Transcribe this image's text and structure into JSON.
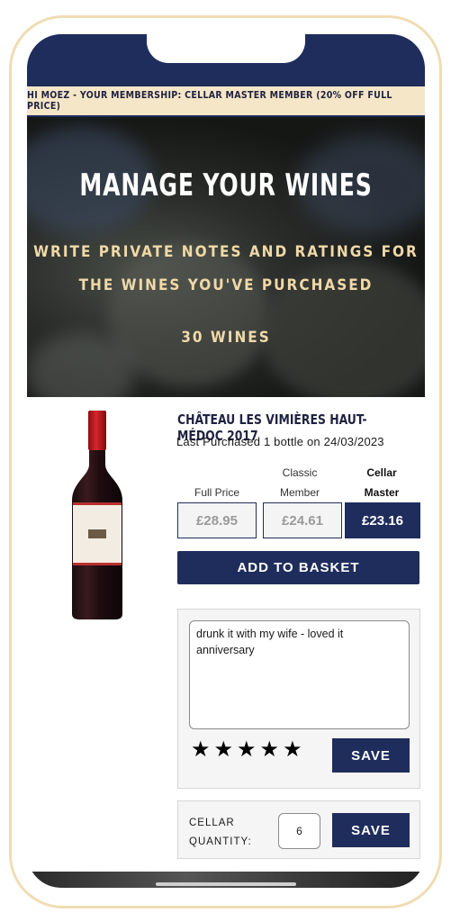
{
  "banner": {
    "text": "HI MOEZ - YOUR MEMBERSHIP: CELLAR MASTER MEMBER (20% OFF FULL PRICE)"
  },
  "hero": {
    "title": "MANAGE YOUR WINES",
    "subtitle": "WRITE PRIVATE NOTES AND RATINGS FOR THE WINES YOU'VE PURCHASED",
    "count": "30 WINES"
  },
  "product": {
    "name": "CHÂTEAU LES VIMIÈRES HAUT-MÉDOC 2017",
    "last_purchased": "Last Purchased 1 bottle on 24/03/2023",
    "bottle_label": "Château les Vimières",
    "bottle_sublabel": "HAUT-MÉDOC",
    "bottle_year": "2017"
  },
  "prices": {
    "full": {
      "label": "Full Price",
      "value": "£28.95"
    },
    "classic": {
      "label_line1": "Classic",
      "label_line2": "Member",
      "value": "£24.61"
    },
    "cellar": {
      "label_line1": "Cellar",
      "label_line2": "Master",
      "value": "£23.16"
    }
  },
  "actions": {
    "add_to_basket": "ADD TO BASKET",
    "save_notes": "SAVE",
    "save_quantity": "SAVE"
  },
  "notes": {
    "text": "drunk it with my wife - loved it\nanniversary"
  },
  "rating": {
    "stars": 5,
    "max": 5
  },
  "cellar": {
    "label": "CELLAR QUANTITY:",
    "quantity": "6"
  },
  "colors": {
    "navy": "#1f2d5c",
    "cream": "#f5e6c8",
    "gold_text": "#f0d9a8",
    "frame": "#f0dcb4"
  }
}
